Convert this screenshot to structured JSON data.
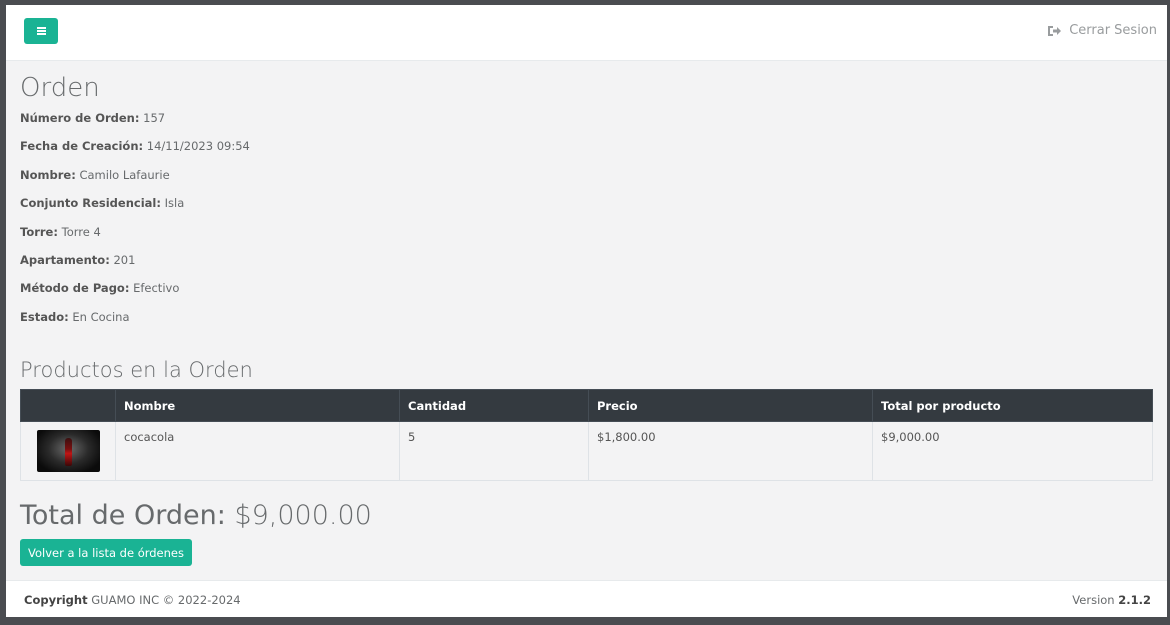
{
  "header": {
    "logout_label": "Cerrar Sesion"
  },
  "order": {
    "title": "Orden",
    "fields": [
      {
        "label": "Número de Orden:",
        "value": "157"
      },
      {
        "label": "Fecha de Creación:",
        "value": "14/11/2023 09:54"
      },
      {
        "label": "Nombre:",
        "value": "Camilo Lafaurie"
      },
      {
        "label": "Conjunto Residencial:",
        "value": "Isla"
      },
      {
        "label": "Torre:",
        "value": "Torre 4"
      },
      {
        "label": "Apartamento:",
        "value": "201"
      },
      {
        "label": "Método de Pago:",
        "value": "Efectivo"
      },
      {
        "label": "Estado:",
        "value": "En Cocina"
      }
    ]
  },
  "products": {
    "title": "Productos en la Orden",
    "columns": [
      "",
      "Nombre",
      "Cantidad",
      "Precio",
      "Total por producto"
    ],
    "rows": [
      {
        "name": "cocacola",
        "quantity": "5",
        "price": "$1,800.00",
        "total": "$9,000.00"
      }
    ]
  },
  "summary": {
    "total_label": "Total de Orden:",
    "total_value": "$9,000.00",
    "back_button_label": "Volver a la lista de órdenes"
  },
  "footer": {
    "copyright_label": "Copyright",
    "copyright_text": "GUAMO INC © 2022-2024",
    "version_label": "Version",
    "version_value": "2.1.2"
  },
  "colors": {
    "accent": "#1ab394",
    "table_header": "#343a40"
  }
}
